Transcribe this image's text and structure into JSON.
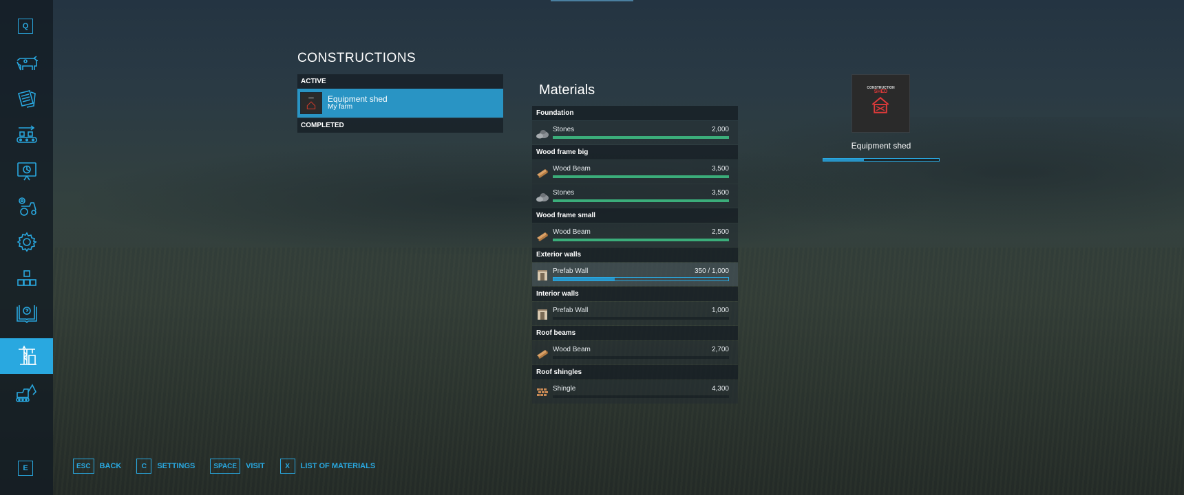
{
  "sidebar": {
    "top_key": "Q",
    "bottom_key": "E",
    "items": [
      {
        "icon": "cow-icon"
      },
      {
        "icon": "contracts-icon"
      },
      {
        "icon": "production-icon"
      },
      {
        "icon": "statistics-icon"
      },
      {
        "icon": "vehicles-icon"
      },
      {
        "icon": "settings-gear-icon"
      },
      {
        "icon": "blocks-icon"
      },
      {
        "icon": "help-book-icon"
      },
      {
        "icon": "construction-crane-icon",
        "active": true
      },
      {
        "icon": "excavator-icon"
      }
    ]
  },
  "constructions": {
    "title": "CONSTRUCTIONS",
    "active_label": "ACTIVE",
    "completed_label": "COMPLETED",
    "active_items": [
      {
        "title": "Equipment shed",
        "subtitle": "My farm"
      }
    ]
  },
  "materials": {
    "title": "Materials",
    "sections": [
      {
        "name": "Foundation",
        "rows": [
          {
            "icon": "stones",
            "name": "Stones",
            "value": "2,000",
            "progress": 1.0,
            "style": "green"
          }
        ]
      },
      {
        "name": "Wood frame big",
        "rows": [
          {
            "icon": "wood",
            "name": "Wood Beam",
            "value": "3,500",
            "progress": 1.0,
            "style": "green"
          },
          {
            "icon": "stones",
            "name": "Stones",
            "value": "3,500",
            "progress": 1.0,
            "style": "green"
          }
        ]
      },
      {
        "name": "Wood frame small",
        "rows": [
          {
            "icon": "wood",
            "name": "Wood Beam",
            "value": "2,500",
            "progress": 1.0,
            "style": "green"
          }
        ]
      },
      {
        "name": "Exterior walls",
        "rows": [
          {
            "icon": "wall",
            "name": "Prefab Wall",
            "value": "350 / 1,000",
            "progress": 0.35,
            "style": "blue",
            "selected": true
          }
        ]
      },
      {
        "name": "Interior walls",
        "rows": [
          {
            "icon": "wall",
            "name": "Prefab Wall",
            "value": "1,000",
            "progress": 0,
            "style": "green"
          }
        ]
      },
      {
        "name": "Roof beams",
        "rows": [
          {
            "icon": "wood",
            "name": "Wood Beam",
            "value": "2,700",
            "progress": 0,
            "style": "green"
          }
        ]
      },
      {
        "name": "Roof shingles",
        "rows": [
          {
            "icon": "shingle",
            "name": "Shingle",
            "value": "4,300",
            "progress": 0,
            "style": "green"
          }
        ]
      }
    ]
  },
  "detail": {
    "thumb_line1": "CONSTRUCTION",
    "thumb_line2": "SHED",
    "name": "Equipment shed",
    "progress": 0.35
  },
  "controls": [
    {
      "key": "ESC",
      "label": "BACK"
    },
    {
      "key": "C",
      "label": "SETTINGS"
    },
    {
      "key": "SPACE",
      "label": "VISIT"
    },
    {
      "key": "X",
      "label": "LIST OF MATERIALS"
    }
  ],
  "colors": {
    "accent": "#29a8e0",
    "progress_green": "#3bad7a",
    "selected_item": "#2994c4",
    "shed_red": "#e03a3a"
  }
}
